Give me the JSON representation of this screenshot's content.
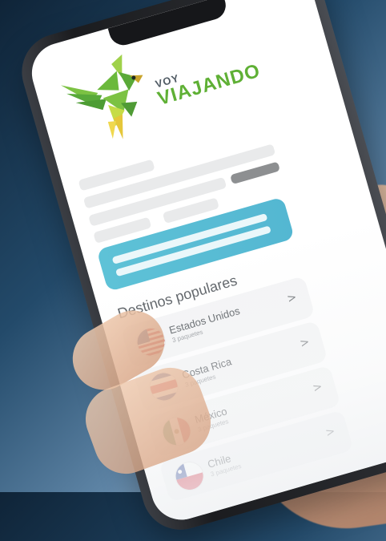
{
  "brand": {
    "small": "VOY",
    "name": "VIAJANDO",
    "logo_icon": "parrot-logo"
  },
  "section": {
    "title": "Destinos populares"
  },
  "destinations": [
    {
      "name": "Estados Unidos",
      "packages": "3 paquetes",
      "flag": "usa-flag-icon",
      "chevron": ">"
    },
    {
      "name": "Costa Rica",
      "packages": "3 paquetes",
      "flag": "costa-rica-flag-icon",
      "chevron": ">"
    },
    {
      "name": "México",
      "packages": "3 paquetes",
      "flag": "mexico-flag-icon",
      "chevron": ">"
    },
    {
      "name": "Chile",
      "packages": "3 paquetes",
      "flag": "chile-flag-icon",
      "chevron": ">"
    }
  ],
  "colors": {
    "brand_green": "#5fb035",
    "search_accent": "#5ec2d7",
    "placeholder": "#e9eaeb"
  }
}
